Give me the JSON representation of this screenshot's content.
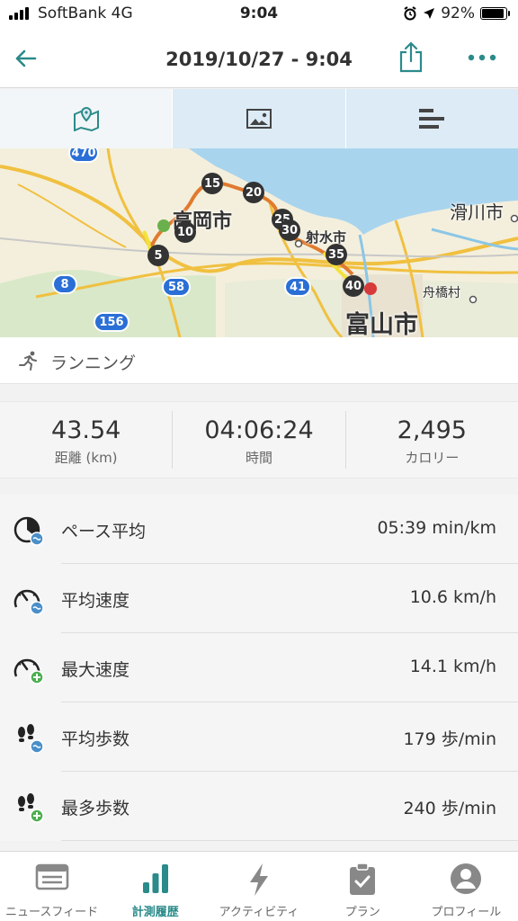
{
  "status_bar": {
    "carrier": "SoftBank 4G",
    "time": "9:04",
    "battery": "92%",
    "battery_level": 0.92
  },
  "nav": {
    "title": "2019/10/27 - 9:04",
    "back_icon": "back-arrow-icon",
    "share_icon": "share-icon",
    "more_icon": "more-icon"
  },
  "view_tabs": [
    {
      "icon": "map-icon",
      "active": true
    },
    {
      "icon": "photo-icon",
      "active": false
    },
    {
      "icon": "bar-chart-icon",
      "active": false
    }
  ],
  "map": {
    "cities": [
      "高岡市",
      "射水市",
      "富山市",
      "滑川市",
      "舟橋村"
    ],
    "route_markers": [
      "5",
      "10",
      "15",
      "20",
      "25",
      "30",
      "35",
      "40"
    ],
    "road_shields": [
      "470",
      "8",
      "58",
      "41",
      "156"
    ]
  },
  "activity": {
    "label": "ランニング",
    "icon": "running-icon"
  },
  "stats": [
    {
      "value": "43.54",
      "unit": "距離 (km)"
    },
    {
      "value": "04:06:24",
      "unit": "時間"
    },
    {
      "value": "2,495",
      "unit": "カロリー"
    }
  ],
  "metrics": [
    {
      "label": "ペース平均",
      "value": "05:39 min/km",
      "icon": "pace-average-icon"
    },
    {
      "label": "平均速度",
      "value": "10.6 km/h",
      "icon": "speed-average-icon"
    },
    {
      "label": "最大速度",
      "value": "14.1 km/h",
      "icon": "speed-max-icon"
    },
    {
      "label": "平均歩数",
      "value": "179 歩/min",
      "icon": "cadence-average-icon"
    },
    {
      "label": "最多歩数",
      "value": "240 歩/min",
      "icon": "cadence-max-icon"
    }
  ],
  "tab_bar": [
    {
      "label": "ニュースフィード",
      "icon": "newsfeed-icon",
      "active": false
    },
    {
      "label": "計測履歴",
      "icon": "history-icon",
      "active": true
    },
    {
      "label": "アクティビティ",
      "icon": "activity-icon",
      "active": false
    },
    {
      "label": "プラン",
      "icon": "plan-icon",
      "active": false
    },
    {
      "label": "プロフィール",
      "icon": "profile-icon",
      "active": false
    }
  ],
  "colors": {
    "accent": "#2b8a8a",
    "route_orange": "#e07a2e",
    "route_yellow": "#f2e23a",
    "start": "#6ab04c",
    "finish": "#d63a3a",
    "sea": "#a9d4ee",
    "shield_blue": "#2a6fd6"
  }
}
